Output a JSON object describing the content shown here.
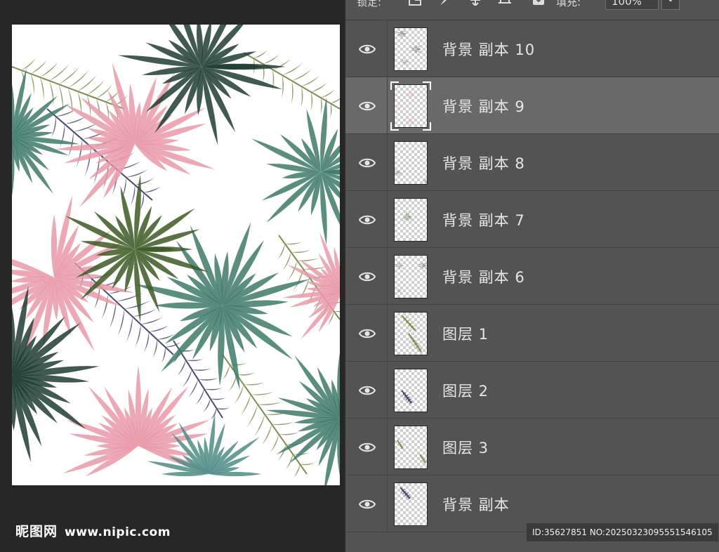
{
  "toolbar": {
    "lock_label": "锁定:",
    "fill_label": "填充:",
    "fill_value": "100%"
  },
  "layers": [
    {
      "name": "背景 副本 10",
      "visible": true,
      "selected": false,
      "thumb": "green-palms"
    },
    {
      "name": "背景 副本 9",
      "visible": true,
      "selected": true,
      "thumb": "pink-palms"
    },
    {
      "name": "背景 副本 8",
      "visible": true,
      "selected": false,
      "thumb": "dark-corners"
    },
    {
      "name": "背景 副本 7",
      "visible": true,
      "selected": false,
      "thumb": "olive-palm"
    },
    {
      "name": "背景 副本 6",
      "visible": true,
      "selected": false,
      "thumb": "teal-palms"
    },
    {
      "name": "图层 1",
      "visible": true,
      "selected": false,
      "thumb": "olive-ferns"
    },
    {
      "name": "图层 2",
      "visible": true,
      "selected": false,
      "thumb": "navy-frond"
    },
    {
      "name": "图层 3",
      "visible": true,
      "selected": false,
      "thumb": "faint-sprigs"
    },
    {
      "name": "背景 副本",
      "visible": true,
      "selected": false,
      "thumb": "navy-frond-small"
    }
  ],
  "watermark": {
    "logo": "昵图网",
    "site": "www.nipic.com",
    "id_text": "ID:35627851 NO:20250323095551546105"
  },
  "colors": {
    "panel_bg": "#535353",
    "selected_row": "#696969",
    "canvas_bg": "#262626",
    "palm_pink": "#e99aa8",
    "palm_dark_green": "#1f3d33",
    "palm_teal": "#3f7a6a",
    "palm_olive": "#7d8f4e",
    "frond_navy": "#4a4870"
  }
}
